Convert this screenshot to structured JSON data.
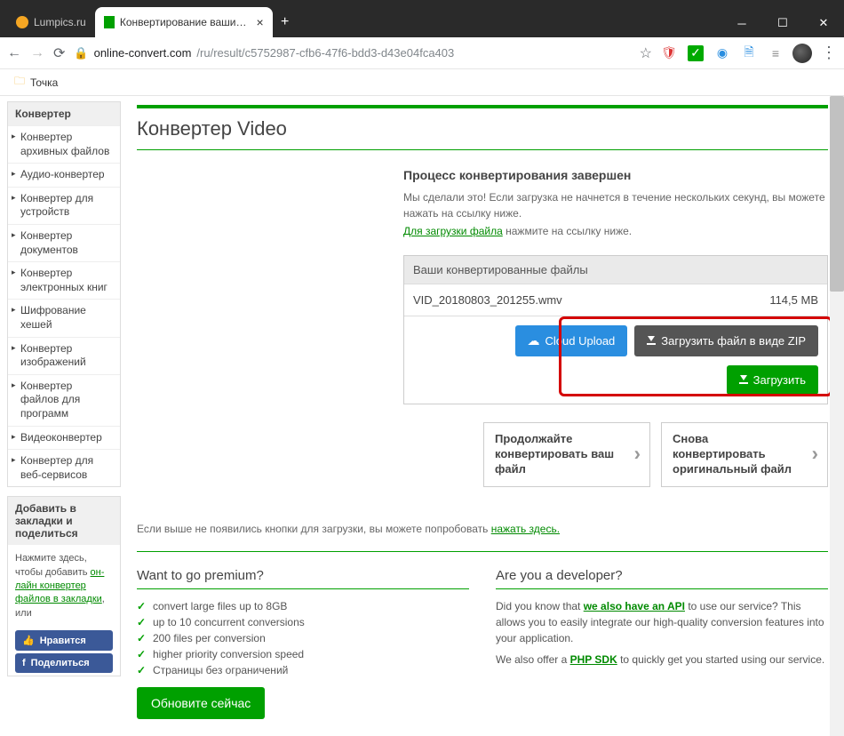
{
  "tabs": [
    {
      "title": "Lumpics.ru",
      "active": false
    },
    {
      "title": "Конвертирование ваших файл",
      "active": true
    }
  ],
  "url": {
    "host": "online-convert.com",
    "path": "/ru/result/c5752987-cfb6-47f6-bdd3-d43e04fca403"
  },
  "bookmark": "Точка",
  "sidebar_heading": "Конвертер",
  "sidebar_items": [
    "Конвертер архивных файлов",
    "Аудио-конвертер",
    "Конвертер для устройств",
    "Конвертер документов",
    "Конвертер электронных книг",
    "Шифрование хешей",
    "Конвертер изображений",
    "Конвертер файлов для программ",
    "Видеоконвертер",
    "Конвертер для веб-сервисов"
  ],
  "bookmark_block": {
    "heading": "Добавить в закладки и поделиться",
    "text_before": "Нажмите здесь, чтобы добавить ",
    "link": "он-лайн конвертер файлов в закладки",
    "text_after": ", или",
    "like": "Нравится",
    "share": "Поделиться"
  },
  "page_title": "Конвертер Video",
  "done": {
    "title": "Процесс конвертирования завершен",
    "line1": "Мы сделали это! Если загрузка не начнется в течение нескольких секунд, вы можете нажать на ссылку ниже.",
    "link": "Для загрузки файла",
    "line2": " нажмите на ссылку ниже."
  },
  "files": {
    "heading": "Ваши конвертированные файлы",
    "name": "VID_20180803_201255.wmv",
    "size": "114,5 MB"
  },
  "buttons": {
    "cloud": "Cloud Upload",
    "zip": "Загрузить файл в виде ZIP",
    "download": "Загрузить"
  },
  "continue": {
    "left": "Продолжайте конвертировать ваш файл",
    "right": "Снова конвертировать оригинальный файл"
  },
  "fallback": {
    "text": "Если выше не появились кнопки для загрузки, вы можете попробовать ",
    "link": "нажать здесь."
  },
  "premium": {
    "title": "Want to go premium?",
    "features": [
      "convert large files up to 8GB",
      "up to 10 concurrent conversions",
      "200 files per conversion",
      "higher priority conversion speed",
      "Страницы без ограничений"
    ],
    "cta": "Обновите сейчас"
  },
  "developer": {
    "title": "Are you a developer?",
    "p1a": "Did you know that ",
    "p1link": "we also have an API",
    "p1b": " to use our service? This allows you to easily integrate our high-quality conversion features into your application.",
    "p2a": "We also offer a ",
    "p2link": "PHP SDK",
    "p2b": " to quickly get you started using our service."
  }
}
